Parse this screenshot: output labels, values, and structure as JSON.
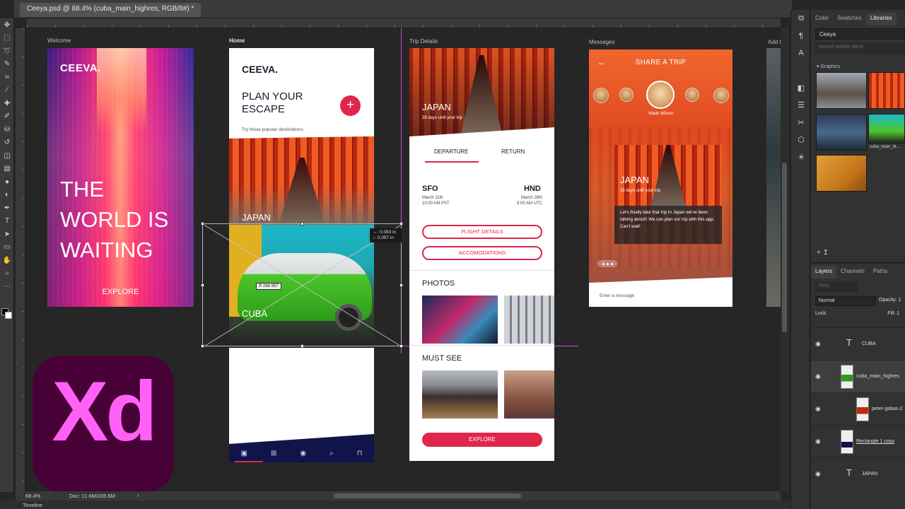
{
  "document": {
    "tab_title": "Ceeya.psd @ 68.4% (cuba_main_highres, RGB/8#) *"
  },
  "tools": [
    "move",
    "marquee",
    "lasso",
    "quick-select",
    "crop",
    "eyedropper",
    "healing",
    "brush",
    "stamp",
    "history-brush",
    "eraser",
    "gradient",
    "blur",
    "dodge",
    "pen",
    "type",
    "path-select",
    "shape",
    "hand",
    "zoom",
    "more"
  ],
  "artboards": {
    "welcome": {
      "label": "Welcome",
      "logo": "CEEVA.",
      "headline": "THE WORLD IS WAITING",
      "cta": "EXPLORE"
    },
    "home": {
      "label": "Home",
      "logo": "CEEVA.",
      "headline": "PLAN YOUR ESCAPE",
      "plus": "+",
      "sub": "Try these popular destinations",
      "dest1": "JAPAN",
      "dest2": "CUBA",
      "plate": "P 266 957"
    },
    "trip": {
      "label": "Trip Details",
      "hero_title": "JAPAN",
      "hero_sub": "28 days until your trip",
      "tab_departure": "DEPARTURE",
      "tab_return": "RETURN",
      "from_code": "SFO",
      "from_date": "March 11th",
      "from_time": "10:00 AM PST",
      "to_code": "HND",
      "to_date": "March 28th",
      "to_time": "9:00 AM UTC",
      "btn_flight": "FLIGHT DETAILS",
      "btn_accom": "ACCOMODATIONS",
      "photos_title": "PHOTOS",
      "must_see_title": "MUST SEE",
      "btn_explore": "EXPLORE"
    },
    "messages": {
      "label": "Messages",
      "back": "←",
      "title": "SHARE A TRIP",
      "active_name": "Wade Wilson",
      "card_title": "JAPAN",
      "card_sub": "28 days until your trip",
      "card_message": "Let's finally take that trip to Japan we've been talking about!! We can plan our trip with this app. Can't wait!",
      "input_placeholder": "Enter a message"
    },
    "next_label": "Add to"
  },
  "transform_readout": {
    "w": "↔: 0.083 in",
    "h": "↕: 0.097 in"
  },
  "xd_logo_text": "Xd",
  "status": {
    "zoom": "68.4%",
    "doc": "Doc: 11.6M/335.6M",
    "arrow": "›",
    "timeline": "Timeline"
  },
  "libraries_panel": {
    "tabs": [
      "Color",
      "Swatches",
      "Libraries"
    ],
    "active_tab": "Libraries",
    "library_name": "Ceeya",
    "search_placeholder": "Search Adobe Stock",
    "section": "▾ Graphics",
    "graphic_caption": "cuba_main_hi...",
    "footer": "+ ↥"
  },
  "layers_panel": {
    "tabs": [
      "Layers",
      "Channels",
      "Paths"
    ],
    "kind_placeholder": "Kind",
    "blend_mode": "Normal",
    "opacity_label": "Opacity: 1",
    "lock_label": "Lock:",
    "fill_label": "Fill: 1",
    "layers": [
      {
        "name": "CUBA",
        "type": "text"
      },
      {
        "name": "cuba_main_highres",
        "type": "image",
        "selected": true
      },
      {
        "name": "peter-gabas-2",
        "type": "image"
      },
      {
        "name": "Rectangle 1 copy",
        "type": "shape"
      },
      {
        "name": "JAPAN",
        "type": "text"
      }
    ]
  },
  "colors": {
    "accent": "#e0264a",
    "xd_bg": "#470137",
    "xd_fg": "#ff61f6",
    "guide": "#c84bd8",
    "navbar": "#10144a"
  }
}
